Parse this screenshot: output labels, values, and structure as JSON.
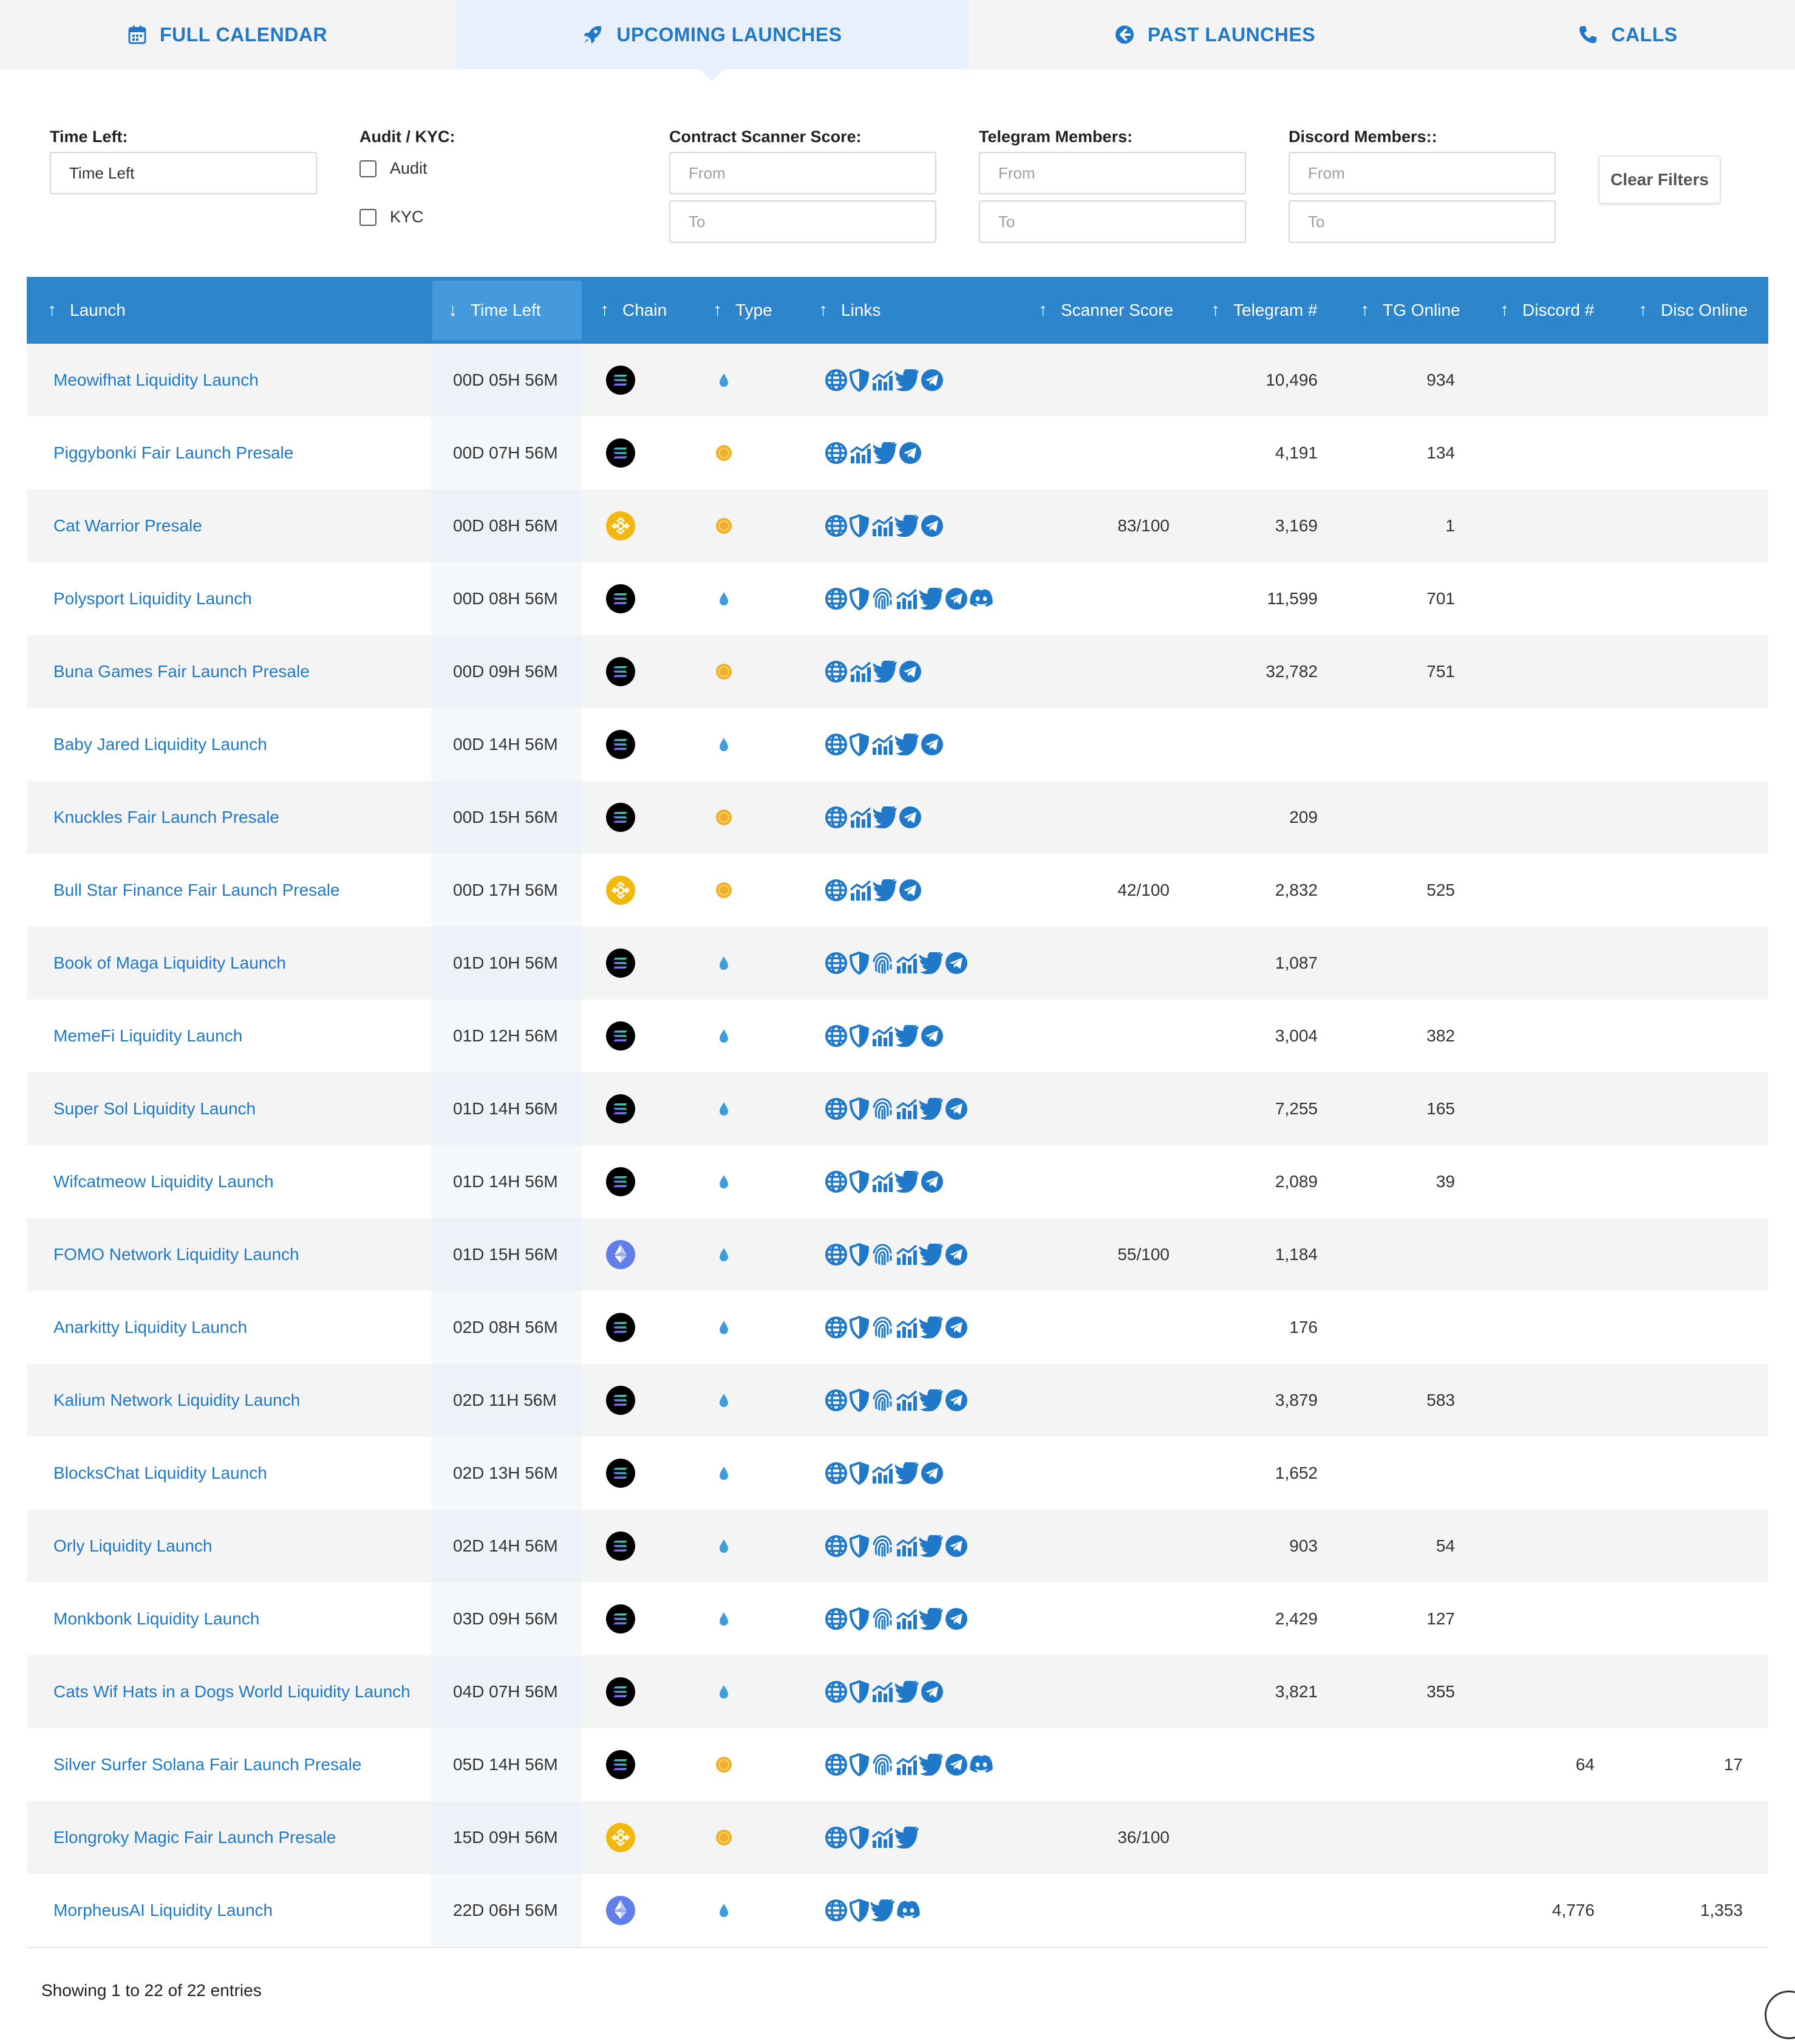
{
  "tabs": [
    {
      "label": "FULL CALENDAR",
      "icon": "calendar-icon",
      "active": false
    },
    {
      "label": "UPCOMING LAUNCHES",
      "icon": "rocket-icon",
      "active": true
    },
    {
      "label": "PAST LAUNCHES",
      "icon": "arrow-left-circle-icon",
      "active": false
    },
    {
      "label": "CALLS",
      "icon": "phone-icon",
      "active": false
    }
  ],
  "filters": {
    "time_left": {
      "label": "Time Left:",
      "value": "Time Left"
    },
    "audit_kyc": {
      "label": "Audit / KYC:",
      "audit_label": "Audit",
      "kyc_label": "KYC"
    },
    "scanner": {
      "label": "Contract Scanner Score:",
      "from_placeholder": "From",
      "to_placeholder": "To"
    },
    "telegram": {
      "label": "Telegram Members:",
      "from_placeholder": "From",
      "to_placeholder": "To"
    },
    "discord": {
      "label": "Discord Members::",
      "from_placeholder": "From",
      "to_placeholder": "To"
    },
    "clear_label": "Clear Filters"
  },
  "table": {
    "columns": [
      {
        "key": "launch",
        "label": "Launch",
        "sort": "asc"
      },
      {
        "key": "time_left",
        "label": "Time Left",
        "sort": "desc",
        "sorted": true
      },
      {
        "key": "chain",
        "label": "Chain",
        "sort": "asc"
      },
      {
        "key": "type",
        "label": "Type",
        "sort": "asc"
      },
      {
        "key": "links",
        "label": "Links",
        "sort": "asc"
      },
      {
        "key": "scanner",
        "label": "Scanner Score",
        "sort": "asc"
      },
      {
        "key": "telegram",
        "label": "Telegram #",
        "sort": "asc"
      },
      {
        "key": "tg_online",
        "label": "TG Online",
        "sort": "asc"
      },
      {
        "key": "discord",
        "label": "Discord #",
        "sort": "asc"
      },
      {
        "key": "disc_online",
        "label": "Disc Online",
        "sort": "asc"
      }
    ],
    "rows": [
      {
        "name": "Meowifhat Liquidity Launch",
        "time_left": "00D 05H 56M",
        "chain": "solana",
        "type": "liquidity",
        "links": [
          "web",
          "shield",
          "chart",
          "twitter",
          "telegram"
        ],
        "scanner": "",
        "telegram": "10,496",
        "tg_online": "934",
        "discord": "",
        "disc_online": ""
      },
      {
        "name": "Piggybonki Fair Launch Presale",
        "time_left": "00D 07H 56M",
        "chain": "solana",
        "type": "presale",
        "links": [
          "web",
          "chart",
          "twitter",
          "telegram"
        ],
        "scanner": "",
        "telegram": "4,191",
        "tg_online": "134",
        "discord": "",
        "disc_online": ""
      },
      {
        "name": "Cat Warrior Presale",
        "time_left": "00D 08H 56M",
        "chain": "bnb",
        "type": "presale",
        "links": [
          "web",
          "shield",
          "chart",
          "twitter",
          "telegram"
        ],
        "scanner": "83/100",
        "telegram": "3,169",
        "tg_online": "1",
        "discord": "",
        "disc_online": ""
      },
      {
        "name": "Polysport Liquidity Launch",
        "time_left": "00D 08H 56M",
        "chain": "solana",
        "type": "liquidity",
        "links": [
          "web",
          "shield",
          "fingerprint",
          "chart",
          "twitter",
          "telegram",
          "discord"
        ],
        "scanner": "",
        "telegram": "11,599",
        "tg_online": "701",
        "discord": "",
        "disc_online": ""
      },
      {
        "name": "Buna Games Fair Launch Presale",
        "time_left": "00D 09H 56M",
        "chain": "solana",
        "type": "presale",
        "links": [
          "web",
          "chart",
          "twitter",
          "telegram"
        ],
        "scanner": "",
        "telegram": "32,782",
        "tg_online": "751",
        "discord": "",
        "disc_online": ""
      },
      {
        "name": "Baby Jared Liquidity Launch",
        "time_left": "00D 14H 56M",
        "chain": "solana",
        "type": "liquidity",
        "links": [
          "web",
          "shield",
          "chart",
          "twitter",
          "telegram"
        ],
        "scanner": "",
        "telegram": "",
        "tg_online": "",
        "discord": "",
        "disc_online": ""
      },
      {
        "name": "Knuckles Fair Launch Presale",
        "time_left": "00D 15H 56M",
        "chain": "solana",
        "type": "presale",
        "links": [
          "web",
          "chart",
          "twitter",
          "telegram"
        ],
        "scanner": "",
        "telegram": "209",
        "tg_online": "",
        "discord": "",
        "disc_online": ""
      },
      {
        "name": "Bull Star Finance Fair Launch Presale",
        "time_left": "00D 17H 56M",
        "chain": "bnb",
        "type": "presale",
        "links": [
          "web",
          "chart",
          "twitter",
          "telegram"
        ],
        "scanner": "42/100",
        "telegram": "2,832",
        "tg_online": "525",
        "discord": "",
        "disc_online": ""
      },
      {
        "name": "Book of Maga Liquidity Launch",
        "time_left": "01D 10H 56M",
        "chain": "solana",
        "type": "liquidity",
        "links": [
          "web",
          "shield",
          "fingerprint",
          "chart",
          "twitter",
          "telegram"
        ],
        "scanner": "",
        "telegram": "1,087",
        "tg_online": "",
        "discord": "",
        "disc_online": ""
      },
      {
        "name": "MemeFi Liquidity Launch",
        "time_left": "01D 12H 56M",
        "chain": "solana",
        "type": "liquidity",
        "links": [
          "web",
          "shield",
          "chart",
          "twitter",
          "telegram"
        ],
        "scanner": "",
        "telegram": "3,004",
        "tg_online": "382",
        "discord": "",
        "disc_online": ""
      },
      {
        "name": "Super Sol Liquidity Launch",
        "time_left": "01D 14H 56M",
        "chain": "solana",
        "type": "liquidity",
        "links": [
          "web",
          "shield",
          "fingerprint",
          "chart",
          "twitter",
          "telegram"
        ],
        "scanner": "",
        "telegram": "7,255",
        "tg_online": "165",
        "discord": "",
        "disc_online": ""
      },
      {
        "name": "Wifcatmeow Liquidity Launch",
        "time_left": "01D 14H 56M",
        "chain": "solana",
        "type": "liquidity",
        "links": [
          "web",
          "shield",
          "chart",
          "twitter",
          "telegram"
        ],
        "scanner": "",
        "telegram": "2,089",
        "tg_online": "39",
        "discord": "",
        "disc_online": ""
      },
      {
        "name": "FOMO Network Liquidity Launch",
        "time_left": "01D 15H 56M",
        "chain": "ethereum",
        "type": "liquidity",
        "links": [
          "web",
          "shield",
          "fingerprint",
          "chart",
          "twitter",
          "telegram"
        ],
        "scanner": "55/100",
        "telegram": "1,184",
        "tg_online": "",
        "discord": "",
        "disc_online": ""
      },
      {
        "name": "Anarkitty Liquidity Launch",
        "time_left": "02D 08H 56M",
        "chain": "solana",
        "type": "liquidity",
        "links": [
          "web",
          "shield",
          "fingerprint",
          "chart",
          "twitter",
          "telegram"
        ],
        "scanner": "",
        "telegram": "176",
        "tg_online": "",
        "discord": "",
        "disc_online": ""
      },
      {
        "name": "Kalium Network Liquidity Launch",
        "time_left": "02D 11H 56M",
        "chain": "solana",
        "type": "liquidity",
        "links": [
          "web",
          "shield",
          "fingerprint",
          "chart",
          "twitter",
          "telegram"
        ],
        "scanner": "",
        "telegram": "3,879",
        "tg_online": "583",
        "discord": "",
        "disc_online": ""
      },
      {
        "name": "BlocksChat Liquidity Launch",
        "time_left": "02D 13H 56M",
        "chain": "solana",
        "type": "liquidity",
        "links": [
          "web",
          "shield",
          "chart",
          "twitter",
          "telegram"
        ],
        "scanner": "",
        "telegram": "1,652",
        "tg_online": "",
        "discord": "",
        "disc_online": ""
      },
      {
        "name": "Orly Liquidity Launch",
        "time_left": "02D 14H 56M",
        "chain": "solana",
        "type": "liquidity",
        "links": [
          "web",
          "shield",
          "fingerprint",
          "chart",
          "twitter",
          "telegram"
        ],
        "scanner": "",
        "telegram": "903",
        "tg_online": "54",
        "discord": "",
        "disc_online": ""
      },
      {
        "name": "Monkbonk Liquidity Launch",
        "time_left": "03D 09H 56M",
        "chain": "solana",
        "type": "liquidity",
        "links": [
          "web",
          "shield",
          "fingerprint",
          "chart",
          "twitter",
          "telegram"
        ],
        "scanner": "",
        "telegram": "2,429",
        "tg_online": "127",
        "discord": "",
        "disc_online": ""
      },
      {
        "name": "Cats Wif Hats in a Dogs World Liquidity Launch",
        "time_left": "04D 07H 56M",
        "chain": "solana",
        "type": "liquidity",
        "links": [
          "web",
          "shield",
          "chart",
          "twitter",
          "telegram"
        ],
        "scanner": "",
        "telegram": "3,821",
        "tg_online": "355",
        "discord": "",
        "disc_online": ""
      },
      {
        "name": "Silver Surfer Solana Fair Launch Presale",
        "time_left": "05D 14H 56M",
        "chain": "solana",
        "type": "presale",
        "links": [
          "web",
          "shield",
          "fingerprint",
          "chart",
          "twitter",
          "telegram",
          "discord"
        ],
        "scanner": "",
        "telegram": "",
        "tg_online": "",
        "discord": "64",
        "disc_online": "17"
      },
      {
        "name": "Elongroky Magic Fair Launch Presale",
        "time_left": "15D 09H 56M",
        "chain": "bnb",
        "type": "presale",
        "links": [
          "web",
          "shield",
          "chart",
          "twitter"
        ],
        "scanner": "36/100",
        "telegram": "",
        "tg_online": "",
        "discord": "",
        "disc_online": ""
      },
      {
        "name": "MorpheusAI Liquidity Launch",
        "time_left": "22D 06H 56M",
        "chain": "ethereum",
        "type": "liquidity",
        "links": [
          "web",
          "shield",
          "twitter",
          "discord"
        ],
        "scanner": "",
        "telegram": "",
        "tg_online": "",
        "discord": "4,776",
        "disc_online": "1,353"
      }
    ],
    "info": "Showing 1 to 22 of 22 entries"
  },
  "colors": {
    "accent": "#1f78c8",
    "header": "#2d86cc",
    "header_sorted": "#4599dd",
    "presale": "#f0b02a",
    "liquidity": "#3d9be0",
    "bnb": "#f0b90b",
    "ethereum": "#627eea"
  }
}
